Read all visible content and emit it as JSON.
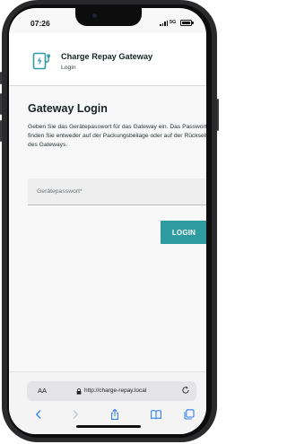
{
  "status_bar": {
    "time": "07:26",
    "network": "5G"
  },
  "app": {
    "title": "Charge Repay Gateway",
    "subtitle": "Login",
    "accent_color": "#2e9ba0",
    "logo_icon": "charger-plug-icon"
  },
  "login": {
    "heading": "Gateway Login",
    "description": "Geben Sie das Gerätepasswort für das Gateway ein. Das Passwort finden Sie entweder auf der Packungsbeilage oder auf der Rückseite des Gateways.",
    "password_field": {
      "placeholder": "Gerätepasswort*",
      "value": ""
    },
    "button_label": "LOGIN"
  },
  "browser": {
    "text_size_label": "AA",
    "url": "http://charge-repay.local",
    "toolbar_icons": [
      "back-icon",
      "forward-icon",
      "share-icon",
      "bookmarks-icon",
      "tabs-icon"
    ]
  }
}
